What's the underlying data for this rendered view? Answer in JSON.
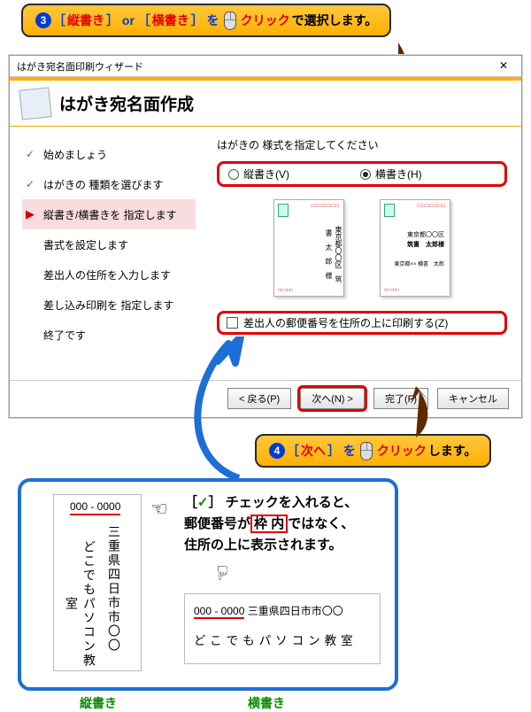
{
  "bubble1": {
    "num": "3",
    "pre": "［",
    "opt1": "縦書き",
    "mid": "］ or ［",
    "opt2": "横書き",
    "post": "］ を",
    "click": "クリック",
    "tail": "で選択します。"
  },
  "bubble2": {
    "num": "4",
    "pre": "［",
    "btn": "次へ",
    "post": "］ を",
    "click": "クリック",
    "tail": "します。"
  },
  "dialog": {
    "title": "はがき宛名面印刷ウィザード",
    "heading": "はがき宛名面作成",
    "pane_caption": "はがきの 様式を指定してください",
    "steps": [
      "始めましょう",
      "はがきの 種類を選びます",
      "縦書き/横書きを 指定します",
      "書式を設定します",
      "差出人の住所を入力します",
      "差し込み印刷を 指定します",
      "終了です"
    ],
    "active_step_index": 2,
    "radio_v": "縦書き(V)",
    "radio_h": "横書き(H)",
    "checkbox_label": "差出人の郵便番号を住所の上に印刷する(Z)",
    "preview": {
      "zip": "□□□□□□□",
      "v_name": "筑　書　太　郎　様",
      "v_addr": "東京都〇〇区",
      "h_addr": "東京都〇〇区",
      "h_name": "筑書　太郎様",
      "h_sender": "東京都××\n横書　太郎",
      "btm_zip": "□□ □□□"
    },
    "buttons": {
      "back": "< 戻る(P)",
      "next": "次へ(N) >",
      "finish": "完了(F)",
      "cancel": "キャンセル"
    }
  },
  "explain": {
    "check_mark": "✓",
    "line1a": "［",
    "line1b": "］ チェックを入れると、",
    "line2a": "郵便番号",
    "line2b": "が",
    "line2c": "枠 内",
    "line2d": "ではなく、",
    "line3": "住所の上に表示されます。",
    "zip": "000 - 0000",
    "addr": "三重県四日市市〇〇",
    "school": "どこでもパソコン教室",
    "cap_v": "縦書き",
    "cap_h": "横書き"
  }
}
